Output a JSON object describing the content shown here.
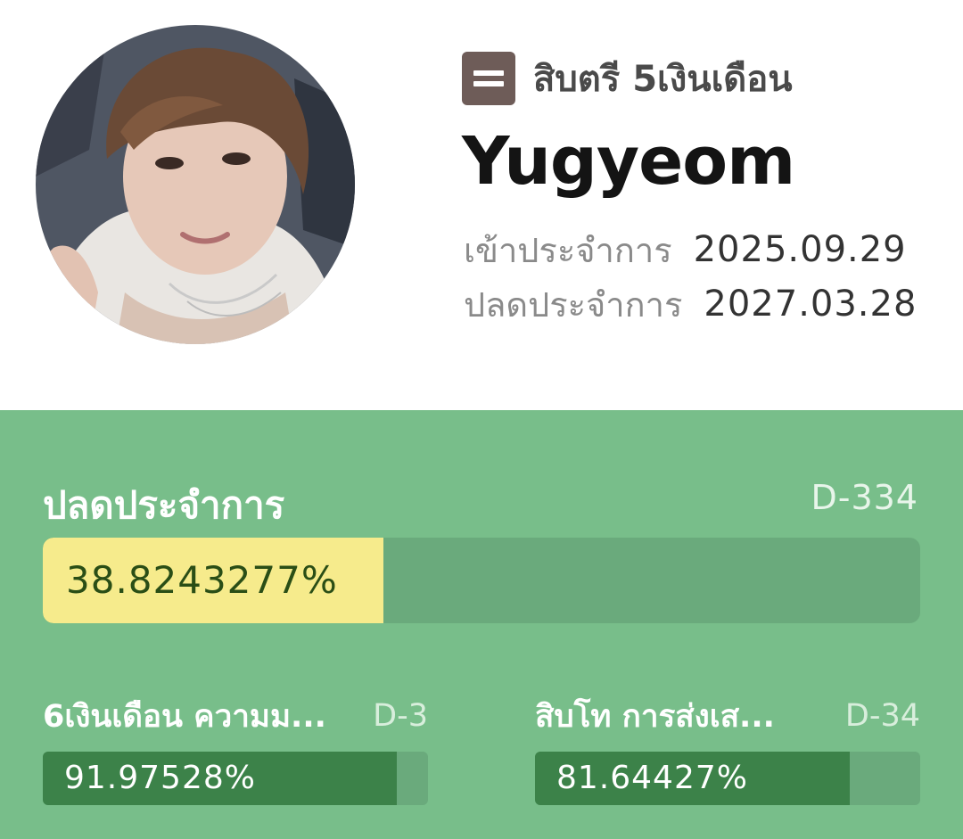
{
  "profile": {
    "rank_icon": "equals-icon",
    "rank_title": "สิบตรี 5เงินเดือน",
    "name": "Yugyeom",
    "enlist_label": "เข้าประจำการ",
    "enlist_date": "2025.09.29",
    "discharge_label": "ปลดประจำการ",
    "discharge_date": "2027.03.28"
  },
  "main_progress": {
    "title": "ปลดประจำการ",
    "dday": "D-334",
    "percent_text": "38.8243277%",
    "percent": 38.8243277
  },
  "sub_progress": [
    {
      "title": "6เงินเดือน ความม...",
      "dday": "D-3",
      "percent_text": "91.97528%",
      "percent": 91.97528
    },
    {
      "title": "สิบโท การส่งเส...",
      "dday": "D-34",
      "percent_text": "81.64427%",
      "percent": 81.64427
    }
  ],
  "colors": {
    "panel_bg": "#78be8a",
    "main_fill": "#f6eb8c",
    "sub_fill": "#3c8249",
    "track": "#6aaa7c",
    "rank_icon_bg": "#6e5c58"
  }
}
